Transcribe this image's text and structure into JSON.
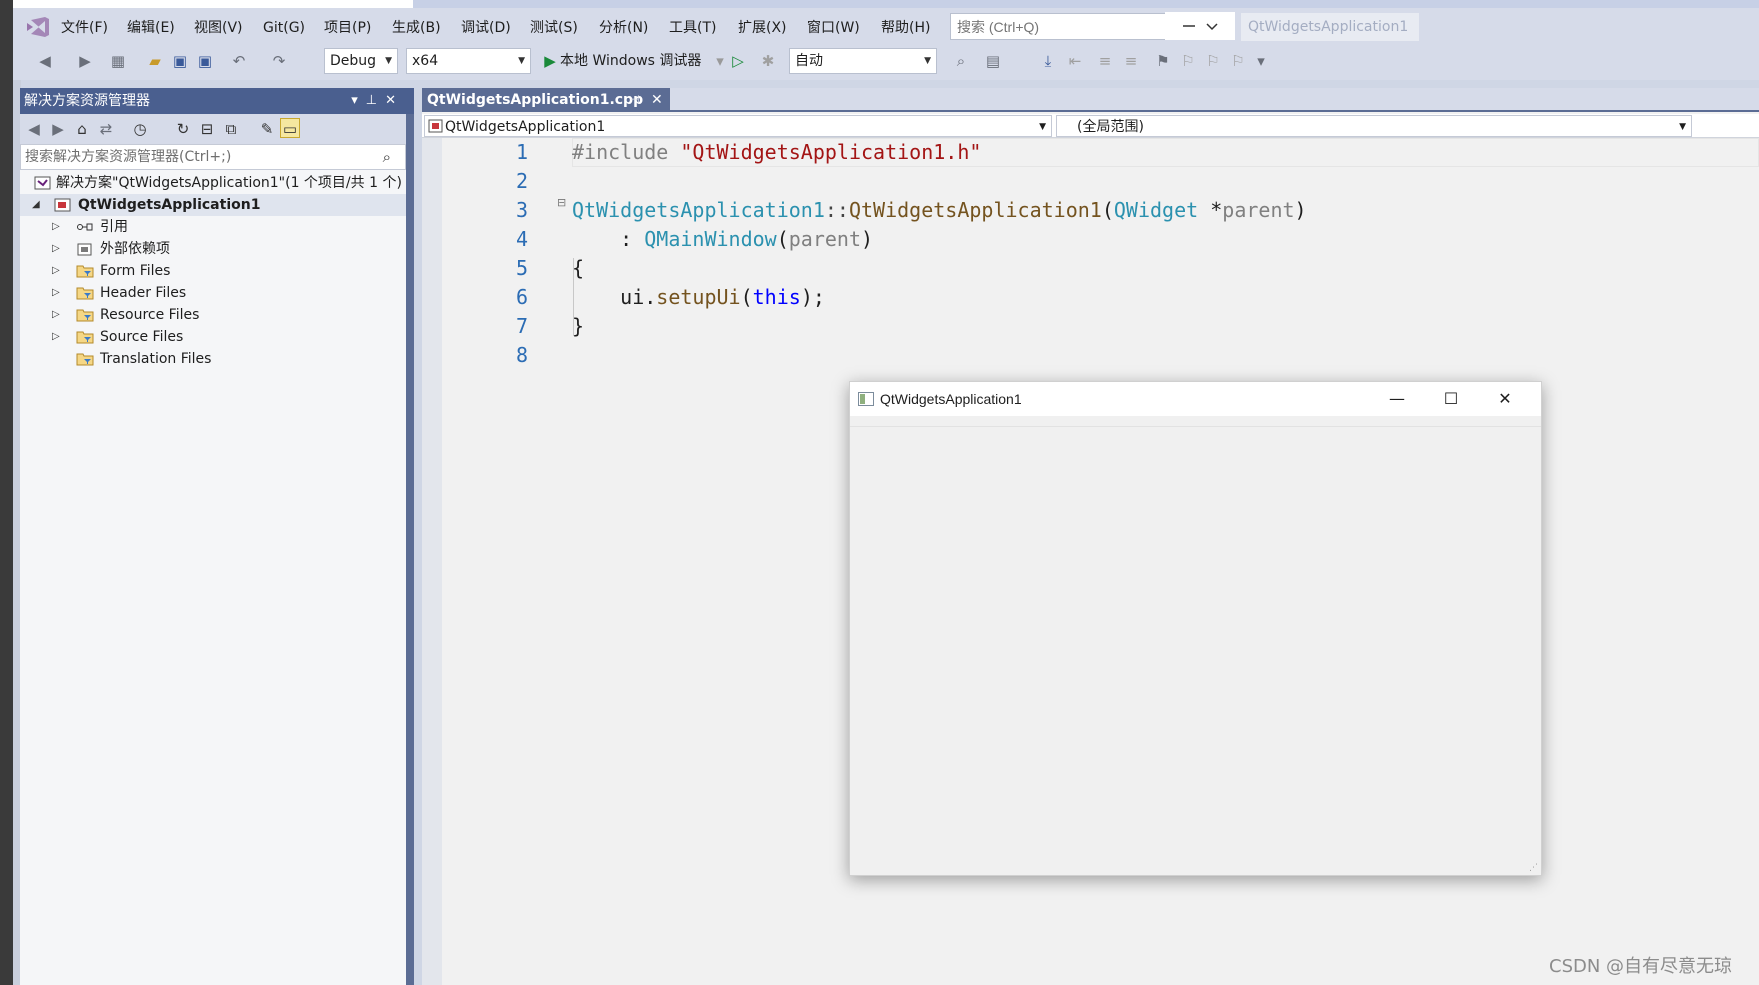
{
  "menu": [
    "文件(F)",
    "编辑(E)",
    "视图(V)",
    "Git(G)",
    "项目(P)",
    "生成(B)",
    "调试(D)",
    "测试(S)",
    "分析(N)",
    "工具(T)",
    "扩展(X)",
    "窗口(W)",
    "帮助(H)"
  ],
  "search": {
    "placeholder": "搜索 (Ctrl+Q)"
  },
  "app_title": "QtWidgetsApplication1",
  "toolbar": {
    "config": "Debug",
    "platform": "x64",
    "run_label": "本地 Windows 调试器",
    "solution_config": "自动"
  },
  "solution_explorer": {
    "title": "解决方案资源管理器",
    "search_placeholder": "搜索解决方案资源管理器(Ctrl+;)",
    "solution": "解决方案\"QtWidgetsApplication1\"(1 个项目/共 1 个)",
    "project": "QtWidgetsApplication1",
    "items": [
      {
        "label": "引用",
        "icon": "reference-icon"
      },
      {
        "label": "外部依赖项",
        "icon": "external-deps-icon"
      },
      {
        "label": "Form Files",
        "icon": "filter-folder-icon"
      },
      {
        "label": "Header Files",
        "icon": "filter-folder-icon"
      },
      {
        "label": "Resource Files",
        "icon": "filter-folder-icon"
      },
      {
        "label": "Source Files",
        "icon": "filter-folder-icon"
      },
      {
        "label": "Translation Files",
        "icon": "filter-folder-icon"
      }
    ]
  },
  "editor": {
    "tab": "QtWidgetsApplication1.cpp",
    "nav_left": "QtWidgetsApplication1",
    "nav_right": "(全局范围)",
    "line_numbers": [
      "1",
      "2",
      "3",
      "4",
      "5",
      "6",
      "7",
      "8"
    ],
    "code": {
      "l1_directive": "#include",
      "l1_string": "\"QtWidgetsApplication1.h\"",
      "l3_class": "QtWidgetsApplication1",
      "l3_sep": "::",
      "l3_ctor": "QtWidgetsApplication1",
      "l3_open": "(",
      "l3_type": "QWidget",
      "l3_star": " *",
      "l3_param": "parent",
      "l3_close": ")",
      "l4_colon": "    : ",
      "l4_base": "QMainWindow",
      "l4_open": "(",
      "l4_param": "parent",
      "l4_close": ")",
      "l5": "{",
      "l6_obj": "    ui.",
      "l6_fn": "setupUi",
      "l6_open": "(",
      "l6_kw": "this",
      "l6_close": ");",
      "l7": "}"
    }
  },
  "qt_window": {
    "title": "QtWidgetsApplication1",
    "minimize": "—",
    "maximize": "☐",
    "close": "✕"
  },
  "watermark": "CSDN @自有尽意无琼",
  "colors": {
    "accent": "#5b6c94",
    "tool_window_title": "#4a5f8f",
    "line_number": "#2b6cb4",
    "string": "#a31515",
    "class": "#2b91af",
    "keyword": "#0000ff"
  }
}
